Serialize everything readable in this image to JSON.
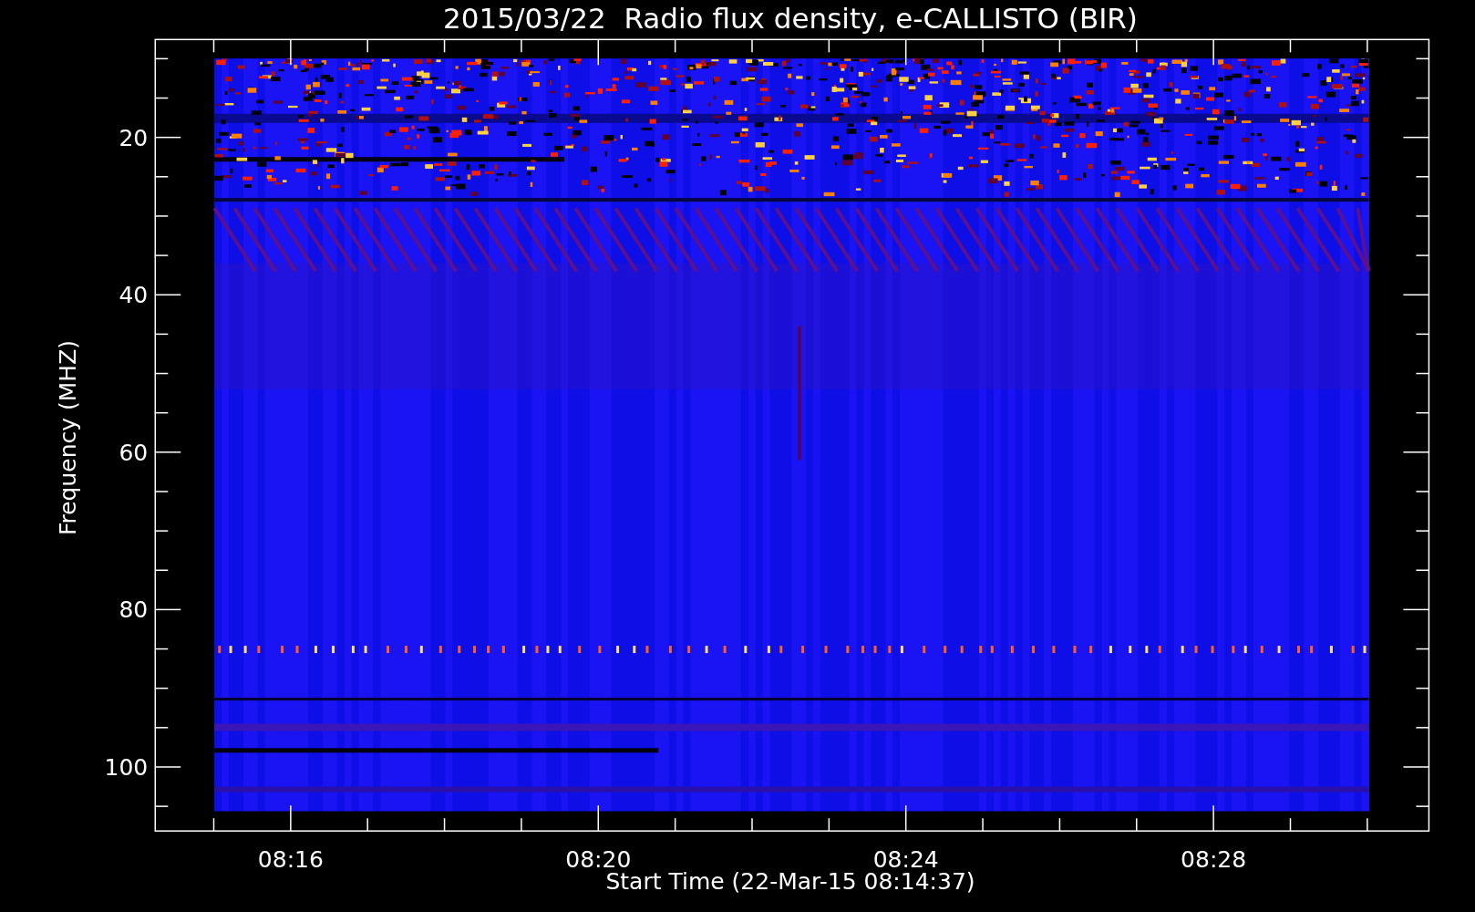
{
  "title": "2015/03/22  Radio flux density, e-CALLISTO (BIR)",
  "y_axis": {
    "label": "Frequency (MHZ)",
    "ticks": [
      "20",
      "40",
      "60",
      "80",
      "100"
    ]
  },
  "x_axis": {
    "label": "Start Time (22-Mar-15 08:14:37)",
    "ticks": [
      "08:16",
      "08:20",
      "08:24",
      "08:28"
    ]
  }
}
